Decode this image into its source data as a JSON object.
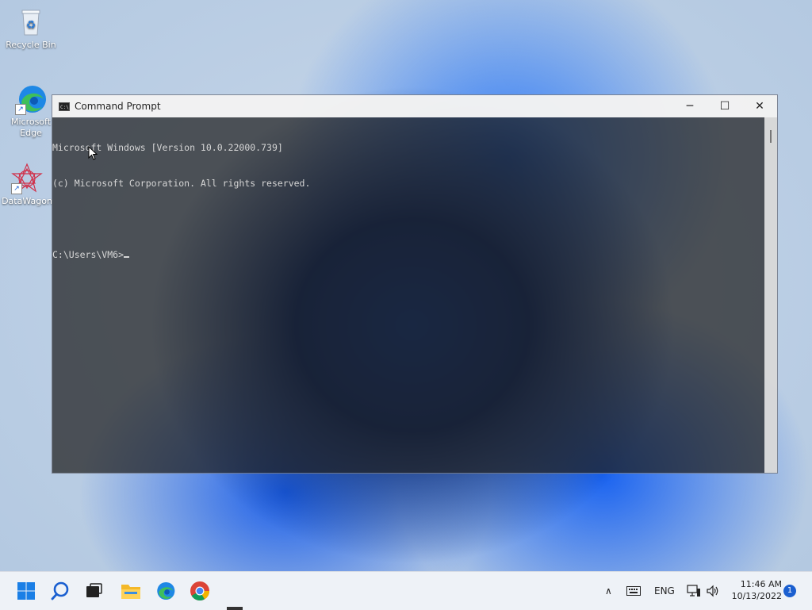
{
  "desktop": {
    "icons": [
      {
        "label": "Recycle Bin",
        "icon": "recycle-bin-icon"
      },
      {
        "label": "Microsoft Edge",
        "icon": "edge-icon"
      },
      {
        "label": "DataWagon",
        "icon": "datawagon-icon"
      }
    ]
  },
  "cmd": {
    "title": "Command Prompt",
    "app_icon_text": "C:\\",
    "controls": {
      "minimize": "─",
      "maximize": "☐",
      "close": "✕"
    },
    "lines": [
      "Microsoft Windows [Version 10.0.22000.739]",
      "(c) Microsoft Corporation. All rights reserved.",
      "",
      "C:\\Users\\VM6>"
    ]
  },
  "taskbar": {
    "tray_language": "ENG",
    "tray_caret": "∧",
    "clock_time": "11:46 AM",
    "clock_date": "10/13/2022",
    "notification_count": "1"
  },
  "colors": {
    "edge_blue": "#1e88e5",
    "edge_green": "#3fbf5a",
    "windows_blue": "#1a7fe6",
    "accent": "#1a5fd0"
  }
}
